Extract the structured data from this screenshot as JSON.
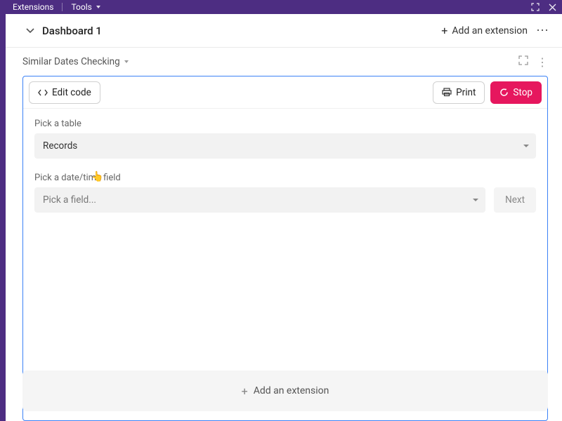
{
  "top_bar": {
    "extensions_label": "Extensions",
    "tools_label": "Tools"
  },
  "dashboard": {
    "title": "Dashboard 1",
    "add_extension_label": "Add an extension"
  },
  "extension": {
    "name": "Similar Dates Checking",
    "toolbar": {
      "edit_code_label": "Edit code",
      "print_label": "Print",
      "stop_label": "Stop"
    },
    "form": {
      "table_label": "Pick a table",
      "table_value": "Records",
      "datetime_label": "Pick a date/time field",
      "datetime_placeholder": "Pick a field...",
      "next_label": "Next"
    }
  },
  "footer": {
    "add_extension_label": "Add an extension"
  }
}
